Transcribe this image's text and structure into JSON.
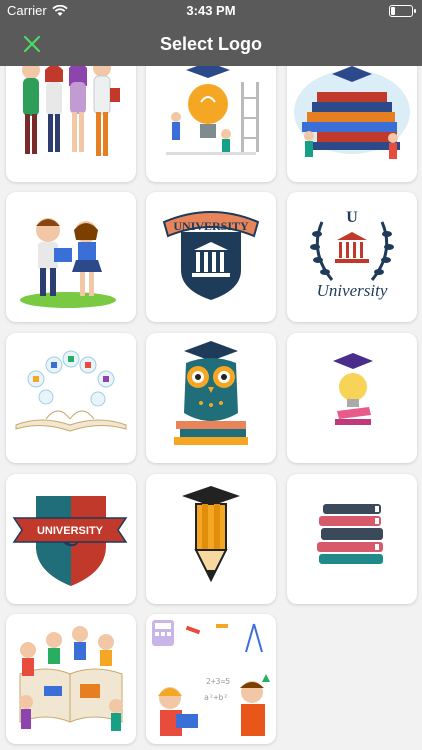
{
  "status_bar": {
    "carrier": "Carrier",
    "time": "3:43 PM"
  },
  "nav": {
    "title": "Select Logo",
    "close_icon": "close-icon"
  },
  "logos": [
    {
      "label": "",
      "icon": "students-group-icon"
    },
    {
      "label": "",
      "icon": "lightbulb-graduation-icon"
    },
    {
      "label": "",
      "icon": "books-study-icon"
    },
    {
      "label": "",
      "icon": "kids-reading-icon"
    },
    {
      "label": "UNIVERSITY",
      "icon": "university-shield-icon"
    },
    {
      "label": "University",
      "icon": "university-laurel-icon"
    },
    {
      "label": "",
      "icon": "open-book-icon"
    },
    {
      "label": "",
      "icon": "owl-graduation-icon"
    },
    {
      "label": "",
      "icon": "bulb-cap-icon"
    },
    {
      "label": "UNIVERSITY",
      "icon": "university-crest-icon"
    },
    {
      "label": "",
      "icon": "pencil-cap-icon"
    },
    {
      "label": "",
      "icon": "book-stack-icon"
    },
    {
      "label": "",
      "icon": "kids-book-icon"
    },
    {
      "label": "",
      "icon": "kids-math-icon"
    }
  ],
  "colors": {
    "bar": "#5a5a5a",
    "accent": "#4cd964",
    "background": "#f2f2f2"
  }
}
